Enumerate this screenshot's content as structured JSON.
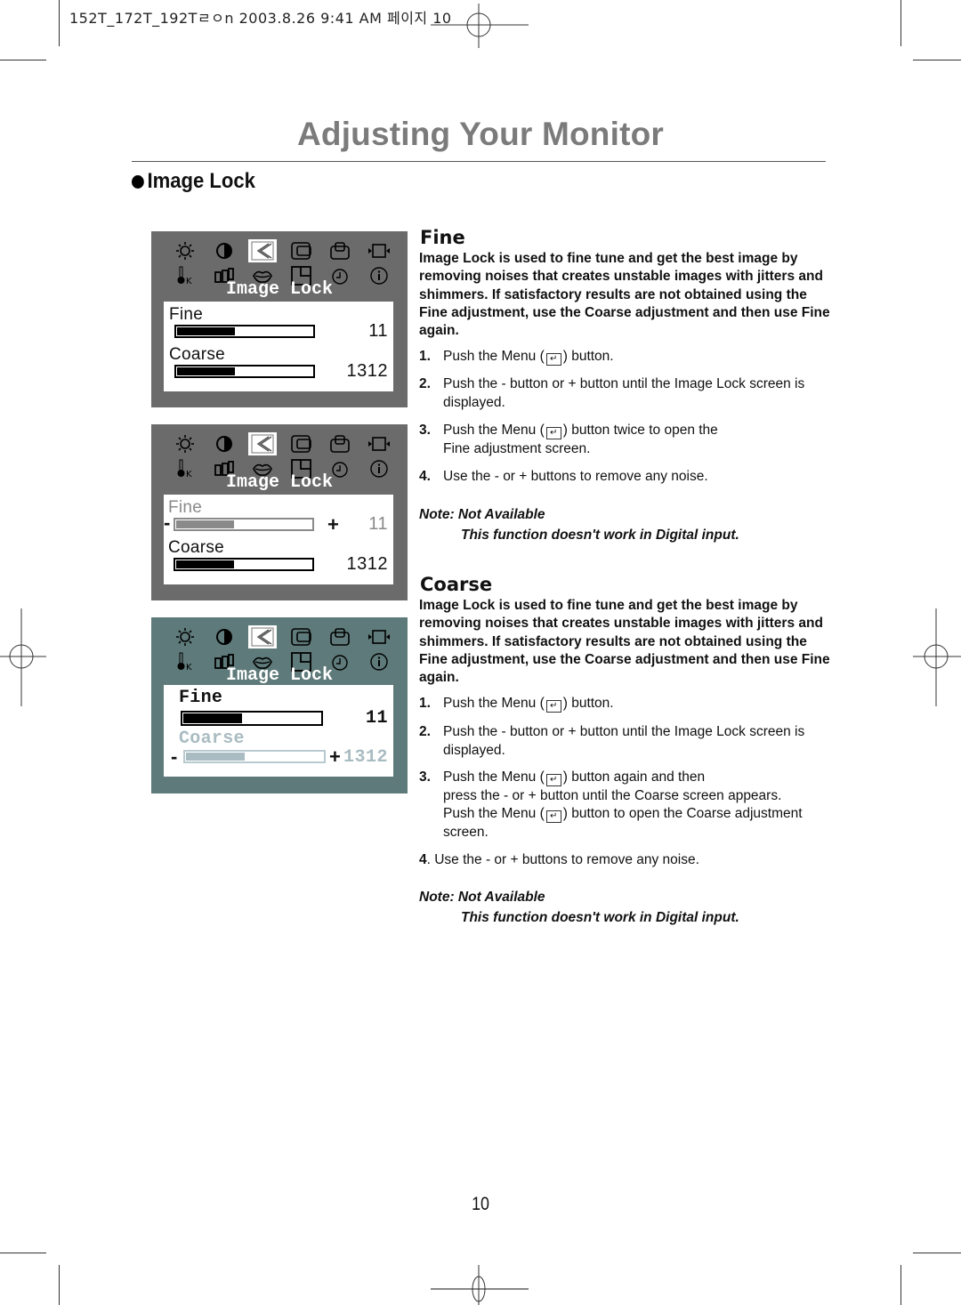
{
  "file_header": "152T_172T_192Tㄹㅇn  2003.8.26 9:41 AM 페이지 10",
  "page": {
    "title": "Adjusting Your Monitor",
    "section": "Image Lock",
    "page_number": "10"
  },
  "osd_panels": [
    {
      "icons": [
        "brightness-icon",
        "contrast-icon",
        "image-lock-icon",
        "position-icon",
        "zoom-icon",
        "size-icon",
        "color-temp-icon",
        "color-control-icon",
        "magicbright-icon",
        "pip-icon",
        "timer-icon",
        "information-icon"
      ],
      "selected_icon": "image-lock-icon",
      "title": "Image Lock",
      "rows": [
        {
          "label": "Fine",
          "value": "11",
          "level_pct": 42,
          "state": "normal"
        },
        {
          "label": "Coarse",
          "value": "1312",
          "level_pct": 42,
          "state": "normal"
        }
      ]
    },
    {
      "title": "Image Lock",
      "minus": "-",
      "plus": "+",
      "rows": [
        {
          "label": "Fine",
          "value": "11",
          "level_pct": 42,
          "state": "active-dim"
        },
        {
          "label": "Coarse",
          "value": "1312",
          "level_pct": 42,
          "state": "normal"
        }
      ]
    },
    {
      "title": "Image Lock",
      "minus": "-",
      "plus": "+",
      "rows": [
        {
          "label": "Fine",
          "value": "11",
          "level_pct": 42,
          "state": "bold"
        },
        {
          "label": "Coarse",
          "value": "1312",
          "level_pct": 42,
          "state": "active-ghost"
        }
      ]
    }
  ],
  "fine": {
    "heading": "Fine",
    "description": "Image Lock is used to fine tune and get the best image by removing noises that creates unstable images with jitters and shimmers. If satisfactory results are not obtained using the Fine adjustment, use the Coarse adjustment and then use Fine again.",
    "steps": [
      {
        "num": "1.",
        "before": "Push the Menu (",
        "after": ") button."
      },
      {
        "num": "2.",
        "text": "Push the - button or + button until the Image Lock screen is displayed."
      },
      {
        "num": "3.",
        "before": "Push the Menu (",
        "after": ") button twice to open the",
        "line2": "Fine adjustment  screen."
      },
      {
        "num": "4.",
        "text": "Use the - or + buttons to remove any noise."
      }
    ],
    "note_heading": "Note: Not Available",
    "note_body": "This function doesn't work in Digital input."
  },
  "coarse": {
    "heading": "Coarse",
    "description": "Image Lock is used to fine tune and get the best image by removing noises that creates unstable images with jitters and shimmers. If satisfactory results are not obtained using the Fine adjustment, use the Coarse adjustment and then use Fine again.",
    "steps": [
      {
        "num": "1.",
        "before": "Push the Menu (",
        "after": ") button."
      },
      {
        "num": "2.",
        "text": "Push the - button or + button until the Image Lock screen is displayed."
      },
      {
        "num": "3.",
        "before": "Push the Menu (",
        "after": ") button again and then",
        "line2": "press the - or + button until the Coarse screen appears.",
        "line3_before": "Push the Menu (",
        "line3_after": ") button to open the Coarse adjustment",
        "line4": "screen."
      },
      {
        "num": "4",
        "text": ". Use the - or + buttons to remove any noise."
      }
    ],
    "note_heading": "Note: Not Available",
    "note_body": "This function doesn't work in Digital input."
  },
  "menu_glyph": "↵"
}
